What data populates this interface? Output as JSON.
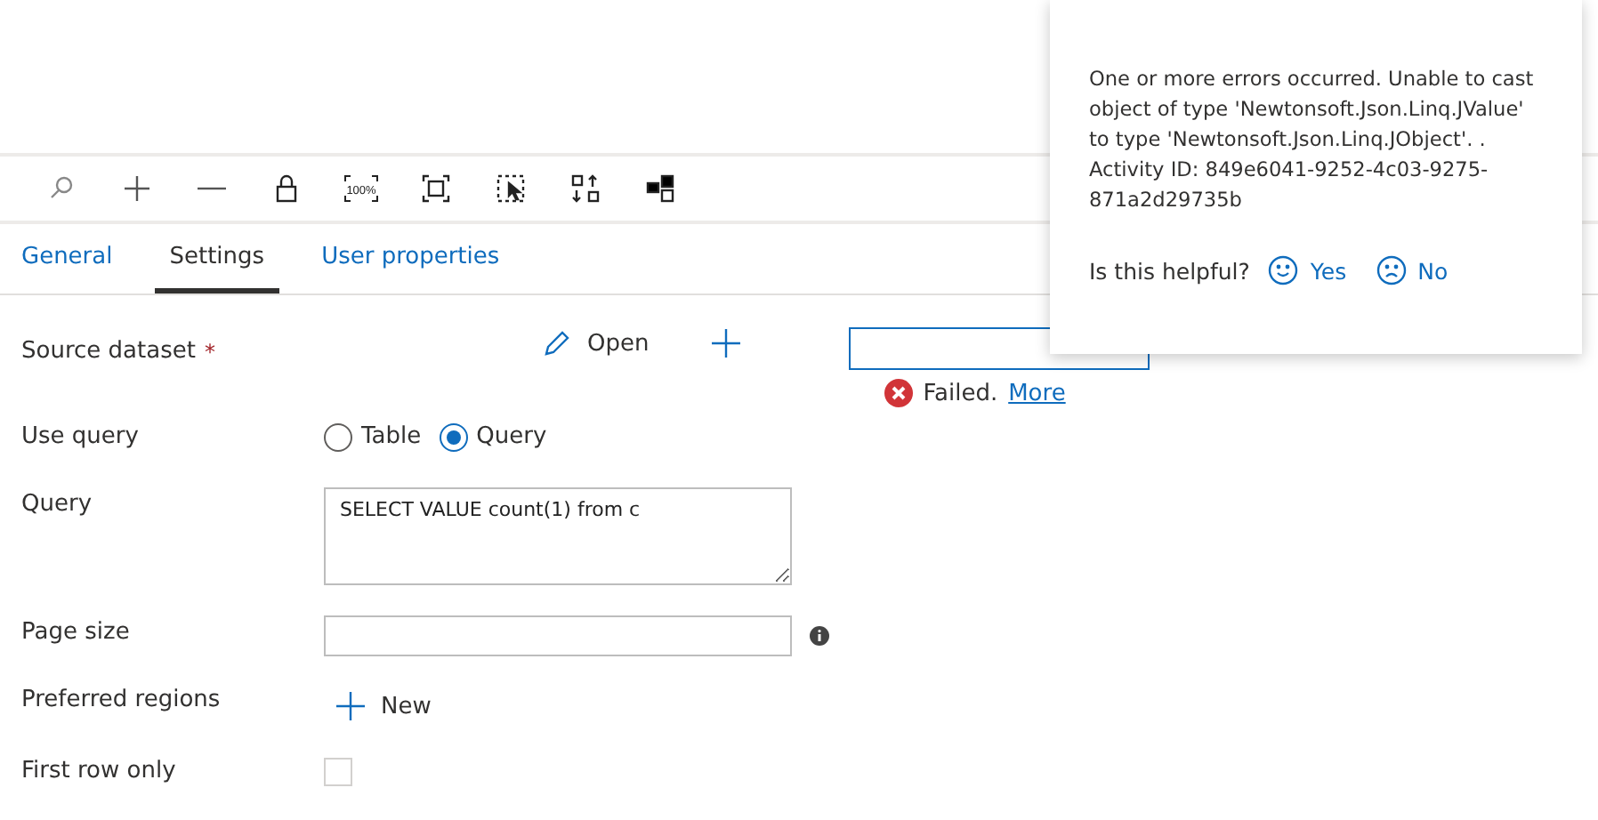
{
  "toolbar": {
    "zoom_label": "100%"
  },
  "tabs": [
    {
      "label": "General",
      "selected": false
    },
    {
      "label": "Settings",
      "selected": true
    },
    {
      "label": "User properties",
      "selected": false
    }
  ],
  "form": {
    "source_dataset": {
      "label": "Source dataset",
      "required_mark": "*",
      "open_label": "Open",
      "status": "Failed.",
      "status_link": "More"
    },
    "use_query": {
      "label": "Use query",
      "options": [
        {
          "label": "Table",
          "selected": false
        },
        {
          "label": "Query",
          "selected": true
        }
      ]
    },
    "query": {
      "label": "Query",
      "value": "SELECT VALUE count(1) from c"
    },
    "page_size": {
      "label": "Page size"
    },
    "preferred_regions": {
      "label": "Preferred regions",
      "new_label": "New"
    },
    "first_row_only": {
      "label": "First row only",
      "checked": false
    }
  },
  "error_popup": {
    "message": "One or more errors occurred. Unable to cast object of type 'Newtonsoft.Json.Linq.JValue' to type 'Newtonsoft.Json.Linq.JObject'. . Activity ID: 849e6041-9252-4c03-9275-871a2d29735b",
    "helpful_prompt": "Is this helpful?",
    "yes": "Yes",
    "no": "No"
  }
}
